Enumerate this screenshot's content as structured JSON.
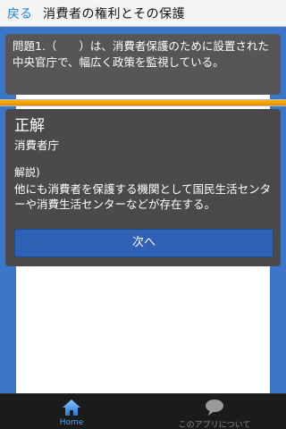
{
  "header": {
    "back_label": "戻る",
    "title": "消費者の権利とその保護"
  },
  "question": {
    "text": "問題1.（　　）は、消費者保護のために設置された中央官庁で、幅広く政策を監視している。"
  },
  "progress": {
    "fraction": 1.0,
    "color": "#f0a000"
  },
  "answer": {
    "result_label": "正解",
    "answer_text": "消費者庁",
    "explanation_label": "解説)",
    "explanation_text": "他にも消費者を保護する機関として国民生活センターや消費生活センターなどが存在する。",
    "next_label": "次へ"
  },
  "tabbar": {
    "home_label": "Home",
    "home_icon": "home-icon",
    "about_label": "このアプリについて",
    "about_icon": "speech-bubble-icon"
  },
  "colors": {
    "accent": "#3b76c8",
    "button": "#2f62b4",
    "active_tab": "#5aa2ee"
  }
}
